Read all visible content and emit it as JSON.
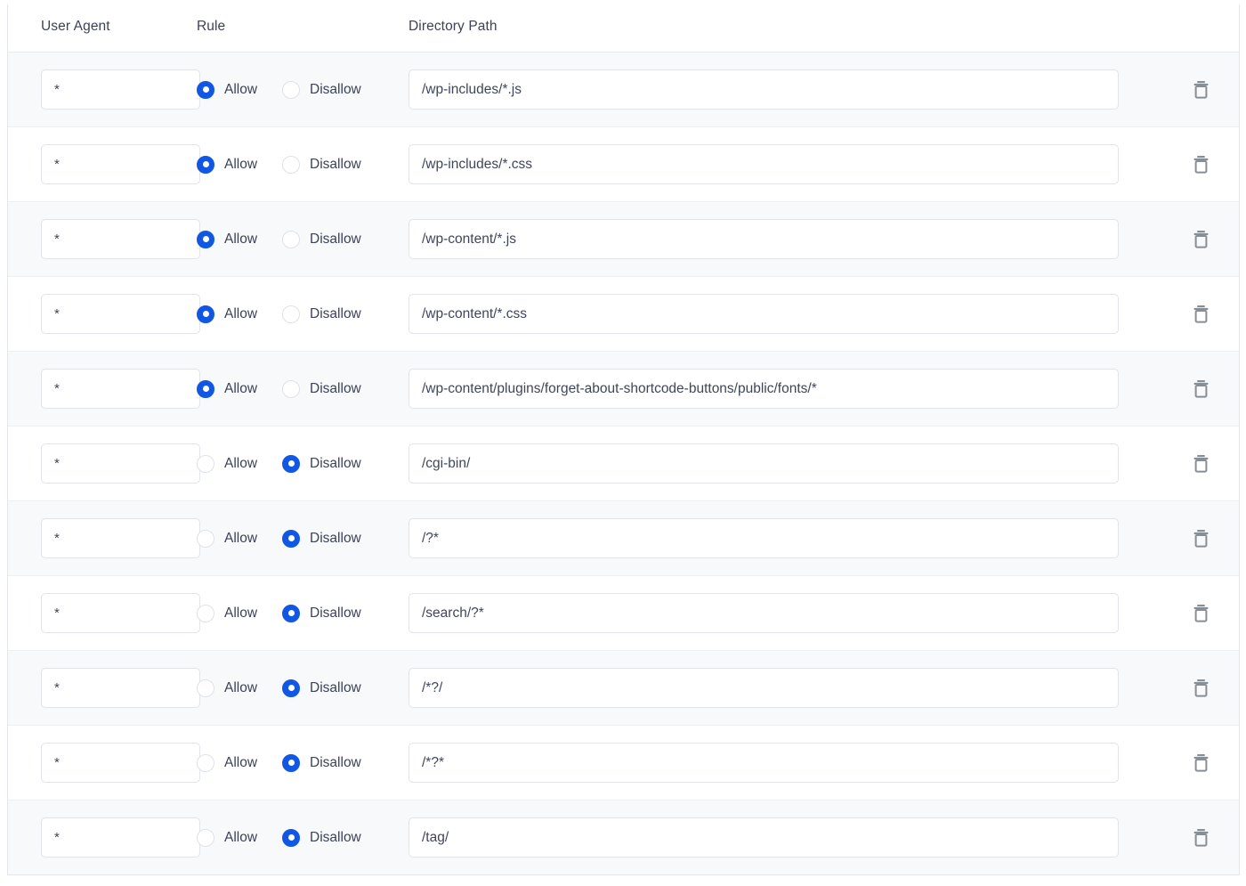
{
  "table": {
    "columns": {
      "user_agent": "User Agent",
      "rule": "Rule",
      "directory_path": "Directory Path",
      "delete": ""
    },
    "rule_options": {
      "allow": "Allow",
      "disallow": "Disallow"
    },
    "icons": {
      "delete": "trash-icon"
    },
    "colors": {
      "radio_selected": "#1257e3",
      "radio_border": "#dfe2e6",
      "row_alt_background": "#f8f9fa",
      "row_background": "#ffffff",
      "border": "#e3e6ea",
      "text": "#3c4257",
      "input_text": "#40465a",
      "icon": "#868e96"
    },
    "rows": [
      {
        "user_agent": "*",
        "rule": "allow",
        "path": "/wp-includes/*.js"
      },
      {
        "user_agent": "*",
        "rule": "allow",
        "path": "/wp-includes/*.css"
      },
      {
        "user_agent": "*",
        "rule": "allow",
        "path": "/wp-content/*.js"
      },
      {
        "user_agent": "*",
        "rule": "allow",
        "path": "/wp-content/*.css"
      },
      {
        "user_agent": "*",
        "rule": "allow",
        "path": "/wp-content/plugins/forget-about-shortcode-buttons/public/fonts/*"
      },
      {
        "user_agent": "*",
        "rule": "disallow",
        "path": "/cgi-bin/"
      },
      {
        "user_agent": "*",
        "rule": "disallow",
        "path": "/?*"
      },
      {
        "user_agent": "*",
        "rule": "disallow",
        "path": "/search/?*"
      },
      {
        "user_agent": "*",
        "rule": "disallow",
        "path": "/*?/"
      },
      {
        "user_agent": "*",
        "rule": "disallow",
        "path": "/*?*"
      },
      {
        "user_agent": "*",
        "rule": "disallow",
        "path": "/tag/"
      }
    ]
  }
}
